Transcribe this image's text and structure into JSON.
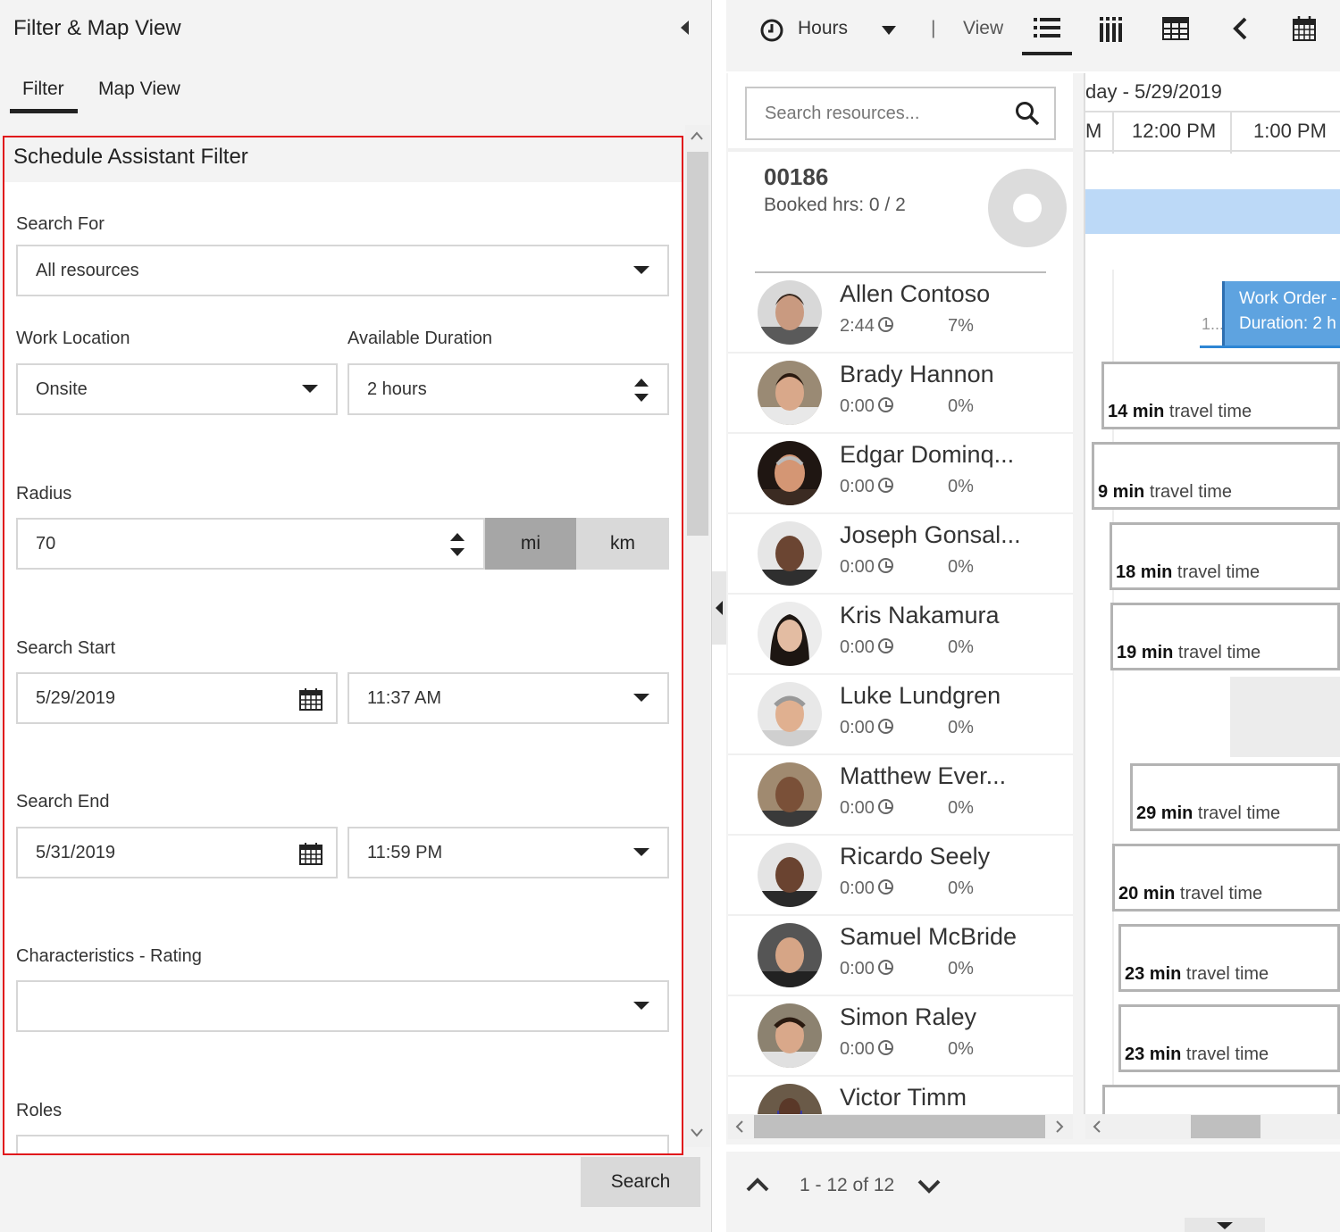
{
  "left_panel": {
    "title": "Filter & Map View",
    "tabs": [
      {
        "label": "Filter",
        "active": true
      },
      {
        "label": "Map View",
        "active": false
      }
    ],
    "filter": {
      "title": "Schedule Assistant Filter",
      "search_for": {
        "label": "Search For",
        "value": "All resources"
      },
      "work_location": {
        "label": "Work Location",
        "value": "Onsite"
      },
      "available_duration": {
        "label": "Available Duration",
        "value": "2 hours"
      },
      "radius": {
        "label": "Radius",
        "value": "70",
        "units": [
          "mi",
          "km"
        ],
        "selected_unit": "mi"
      },
      "search_start": {
        "label": "Search Start",
        "date": "5/29/2019",
        "time": "11:37 AM"
      },
      "search_end": {
        "label": "Search End",
        "date": "5/31/2019",
        "time": "11:59 PM"
      },
      "characteristics": {
        "label": "Characteristics - Rating",
        "value": ""
      },
      "roles": {
        "label": "Roles"
      }
    },
    "search_button": "Search"
  },
  "toolbar": {
    "hours": "Hours",
    "separator": "|",
    "view": "View"
  },
  "resources_panel": {
    "search_placeholder": "Search resources...",
    "requirement": {
      "id": "00186",
      "booked": "Booked hrs: 0 / 2"
    },
    "resources": [
      {
        "name": "Allen Contoso",
        "time": "2:44",
        "pct": "7%"
      },
      {
        "name": "Brady Hannon",
        "time": "0:00",
        "pct": "0%"
      },
      {
        "name": "Edgar Dominq...",
        "time": "0:00",
        "pct": "0%"
      },
      {
        "name": "Joseph Gonsal...",
        "time": "0:00",
        "pct": "0%"
      },
      {
        "name": "Kris Nakamura",
        "time": "0:00",
        "pct": "0%"
      },
      {
        "name": "Luke Lundgren",
        "time": "0:00",
        "pct": "0%"
      },
      {
        "name": "Matthew Ever...",
        "time": "0:00",
        "pct": "0%"
      },
      {
        "name": "Ricardo Seely",
        "time": "0:00",
        "pct": "0%"
      },
      {
        "name": "Samuel McBride",
        "time": "0:00",
        "pct": "0%"
      },
      {
        "name": "Simon Raley",
        "time": "0:00",
        "pct": "0%"
      },
      {
        "name": "Victor Timm",
        "time": "",
        "pct": ""
      }
    ]
  },
  "timeline": {
    "date_header": "day - 5/29/2019",
    "partial_hour": "M",
    "hours": [
      "12:00 PM",
      "1:00 PM"
    ],
    "work_order": {
      "line1": "Work Order -",
      "line2": "Duration: 2 h",
      "tag": "1..."
    },
    "travel": [
      {
        "min": "14 min",
        "text": "travel time"
      },
      {
        "min": "9 min",
        "text": "travel time"
      },
      {
        "min": "18 min",
        "text": "travel time"
      },
      {
        "min": "19 min",
        "text": "travel time"
      },
      {
        "min": "29 min",
        "text": "travel time"
      },
      {
        "min": "20 min",
        "text": "travel time"
      },
      {
        "min": "23 min",
        "text": "travel time"
      },
      {
        "min": "23 min",
        "text": "travel time"
      }
    ]
  },
  "pagination": {
    "text": "1 - 12 of 12"
  }
}
